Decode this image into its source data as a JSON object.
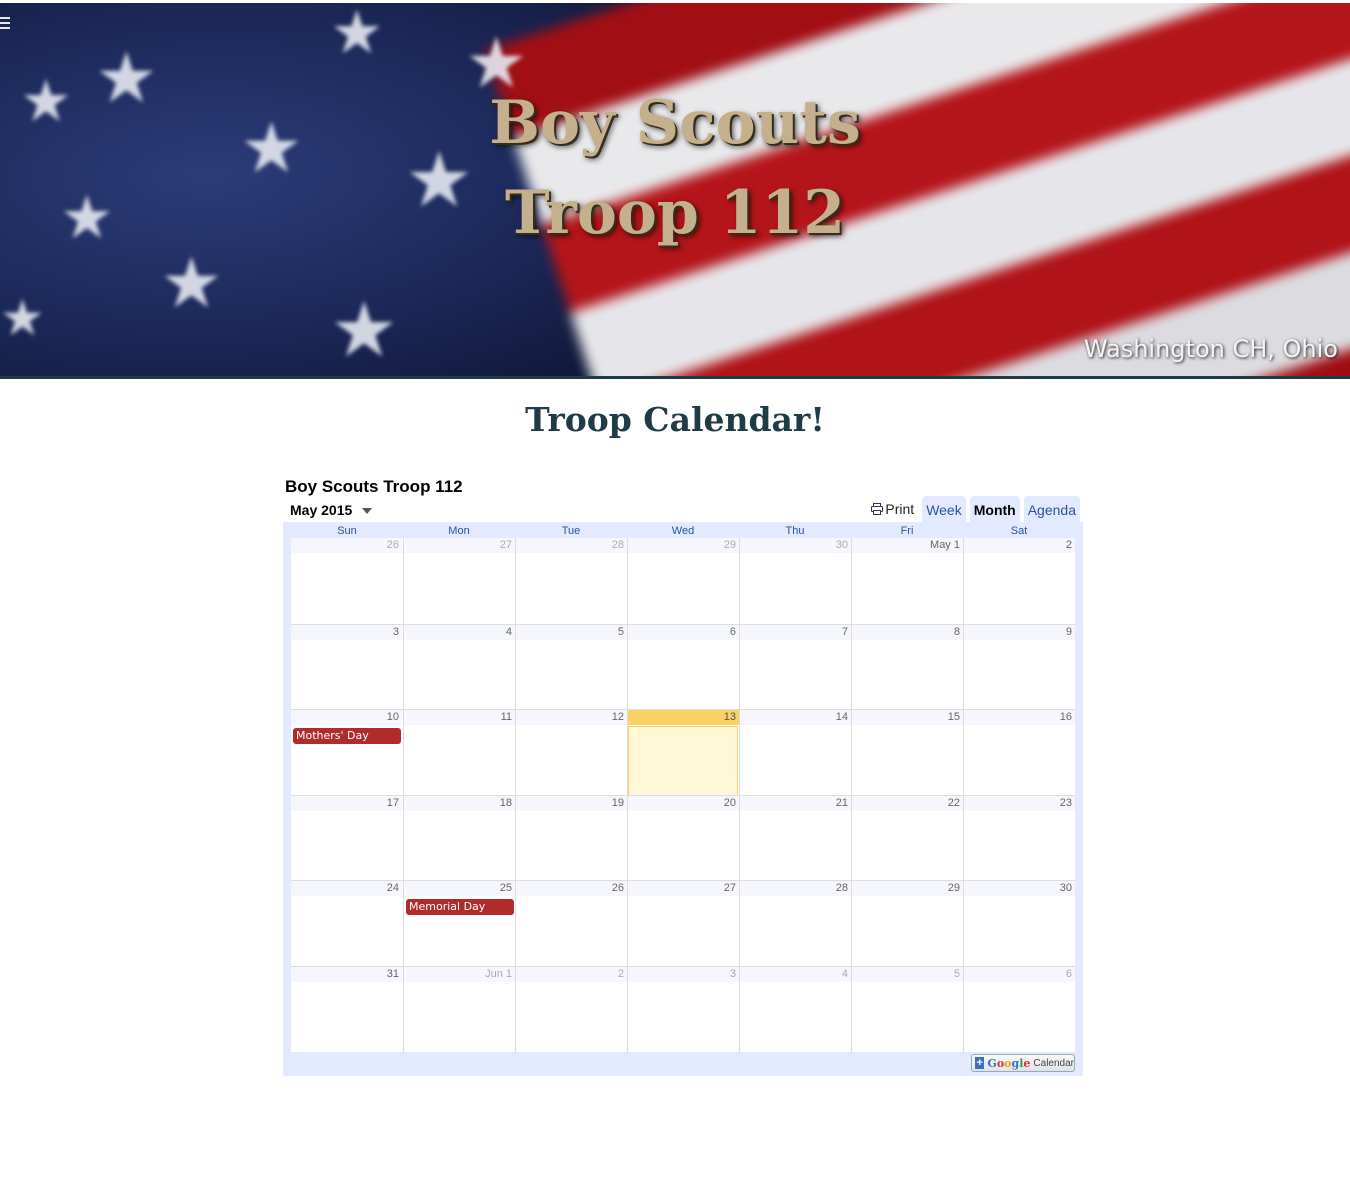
{
  "banner": {
    "title_line1": "Boy Scouts",
    "title_line2": "Troop 112",
    "location": "Washington CH, Ohio"
  },
  "page_heading": "Troop Calendar!",
  "calendar": {
    "title": "Boy Scouts Troop 112",
    "current_month": "May 2015",
    "print_label": "Print",
    "tabs": [
      "Week",
      "Month",
      "Agenda"
    ],
    "active_tab": "Month",
    "weekdays": [
      "Sun",
      "Mon",
      "Tue",
      "Wed",
      "Thu",
      "Fri",
      "Sat"
    ],
    "weeks": [
      [
        {
          "label": "26",
          "other": true
        },
        {
          "label": "27",
          "other": true
        },
        {
          "label": "28",
          "other": true
        },
        {
          "label": "29",
          "other": true
        },
        {
          "label": "30",
          "other": true
        },
        {
          "label": "May 1",
          "other": false
        },
        {
          "label": "2",
          "other": false
        }
      ],
      [
        {
          "label": "3"
        },
        {
          "label": "4"
        },
        {
          "label": "5"
        },
        {
          "label": "6"
        },
        {
          "label": "7"
        },
        {
          "label": "8"
        },
        {
          "label": "9"
        }
      ],
      [
        {
          "label": "10",
          "event": "Mothers' Day"
        },
        {
          "label": "11"
        },
        {
          "label": "12"
        },
        {
          "label": "13",
          "today": true
        },
        {
          "label": "14"
        },
        {
          "label": "15"
        },
        {
          "label": "16"
        }
      ],
      [
        {
          "label": "17"
        },
        {
          "label": "18"
        },
        {
          "label": "19"
        },
        {
          "label": "20"
        },
        {
          "label": "21"
        },
        {
          "label": "22"
        },
        {
          "label": "23"
        }
      ],
      [
        {
          "label": "24"
        },
        {
          "label": "25",
          "event": "Memorial Day"
        },
        {
          "label": "26"
        },
        {
          "label": "27"
        },
        {
          "label": "28"
        },
        {
          "label": "29"
        },
        {
          "label": "30"
        }
      ],
      [
        {
          "label": "31"
        },
        {
          "label": "Jun 1",
          "other": true
        },
        {
          "label": "2",
          "other": true
        },
        {
          "label": "3",
          "other": true
        },
        {
          "label": "4",
          "other": true
        },
        {
          "label": "5",
          "other": true
        },
        {
          "label": "6",
          "other": true
        }
      ]
    ],
    "event_color": "#b02b2c",
    "today_color": "#fad163",
    "google_button": {
      "google_text": "Google",
      "calendar_text": "Calendar"
    }
  }
}
